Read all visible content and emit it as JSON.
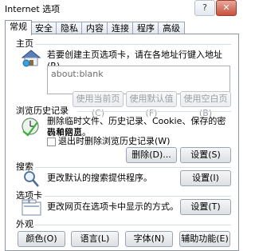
{
  "window": {
    "title": "Internet 选项",
    "help_label": "?",
    "close_label": "✕"
  },
  "tabs": [
    {
      "label": "常规",
      "active": true
    },
    {
      "label": "安全",
      "active": false
    },
    {
      "label": "隐私",
      "active": false
    },
    {
      "label": "内容",
      "active": false
    },
    {
      "label": "连接",
      "active": false
    },
    {
      "label": "程序",
      "active": false
    },
    {
      "label": "高级",
      "active": false
    }
  ],
  "homepage": {
    "group_label": "主页",
    "description": "若要创建主页选项卡，请在各地址行键入地址(R)。",
    "url_value": "about:blank",
    "use_current_label": "使用当前页(C)",
    "use_default_label": "使用默认值(F)",
    "use_blank_label": "使用空白页(B)"
  },
  "history": {
    "group_label": "浏览历史记录",
    "description_line1": "删除临时文件、历史记录、Cookie、保存的密码和网页",
    "description_line2": "表单信息。",
    "checkbox_label": "退出时删除浏览历史记录(W)",
    "delete_label": "删除(D)...",
    "settings_label": "设置(S)"
  },
  "search": {
    "group_label": "搜索",
    "description": "更改默认的搜索提供程序。",
    "settings_label": "设置(I)"
  },
  "tabs_section": {
    "group_label": "选项卡",
    "description": "更改网页在选项卡中显示的方式。",
    "settings_label": "设置(T)"
  },
  "appearance": {
    "group_label": "外观",
    "colors_label": "颜色(O)",
    "languages_label": "语言(L)",
    "fonts_label": "字体(N)",
    "accessibility_label": "辅助功能(E)"
  },
  "colors": {
    "close_button": "#c7513d",
    "group_line": "#d5dfe5",
    "panel_border": "#8b96a6"
  }
}
